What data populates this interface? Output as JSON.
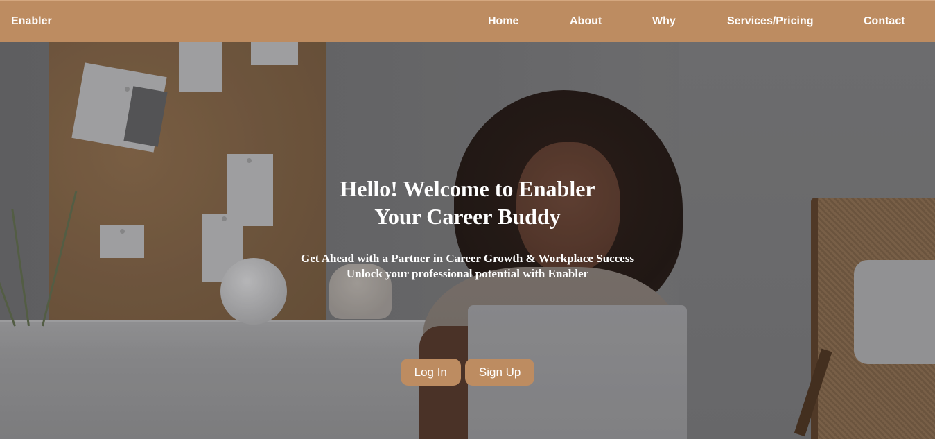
{
  "navbar": {
    "brand": "Enabler",
    "links": [
      {
        "label": "Home"
      },
      {
        "label": "About"
      },
      {
        "label": "Why"
      },
      {
        "label": "Services/Pricing"
      },
      {
        "label": "Contact"
      }
    ]
  },
  "hero": {
    "title_line1": "Hello! Welcome to Enabler",
    "title_line2": "Your Career Buddy",
    "subtitle_line1": "Get Ahead with a Partner in Career Growth & Workplace Success",
    "subtitle_line2": "Unlock your professional potential with Enabler",
    "login_label": "Log In",
    "signup_label": "Sign Up"
  },
  "colors": {
    "accent": "#bd8c61",
    "text": "#ffffff"
  }
}
